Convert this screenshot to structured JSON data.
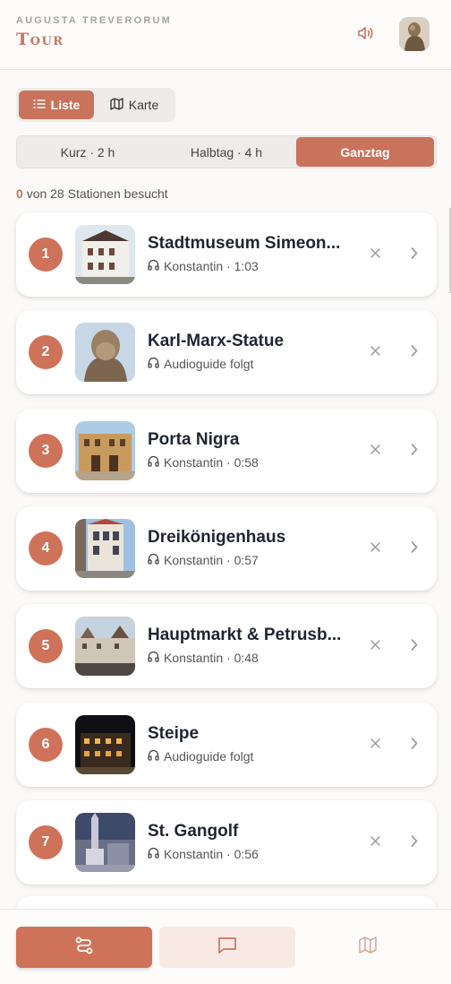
{
  "header": {
    "subtitle": "AUGUSTA TREVERORUM",
    "title": "Tour"
  },
  "view_toggle": {
    "list_label": "Liste",
    "map_label": "Karte",
    "active": "Liste"
  },
  "durations": {
    "options": [
      "Kurz · 2 h",
      "Halbtag · 4 h",
      "Ganztag"
    ],
    "selected": "Ganztag"
  },
  "progress": {
    "visited": "0",
    "text": "von 28 Stationen besucht"
  },
  "stations": [
    {
      "number": "1",
      "name": "Stadtmuseum Simeon...",
      "meta": "Konstantin · 1:03"
    },
    {
      "number": "2",
      "name": "Karl-Marx-Statue",
      "meta": "Audioguide folgt"
    },
    {
      "number": "3",
      "name": "Porta Nigra",
      "meta": "Konstantin · 0:58"
    },
    {
      "number": "4",
      "name": "Dreikönigenhaus",
      "meta": "Konstantin · 0:57"
    },
    {
      "number": "5",
      "name": "Hauptmarkt & Petrusb...",
      "meta": "Konstantin · 0:48"
    },
    {
      "number": "6",
      "name": "Steipe",
      "meta": "Audioguide folgt"
    },
    {
      "number": "7",
      "name": "St. Gangolf",
      "meta": "Konstantin · 0:56"
    }
  ],
  "colors": {
    "accent": "#cf725a",
    "background": "#fbfaf8",
    "card": "#ffffff"
  },
  "icons": {
    "sound": "volume-icon",
    "list": "list-icon",
    "map": "map-icon",
    "audio": "headphones-icon",
    "remove": "close-icon",
    "open": "chevron-right-icon",
    "route": "route-icon",
    "chat": "chat-bubble-icon"
  }
}
